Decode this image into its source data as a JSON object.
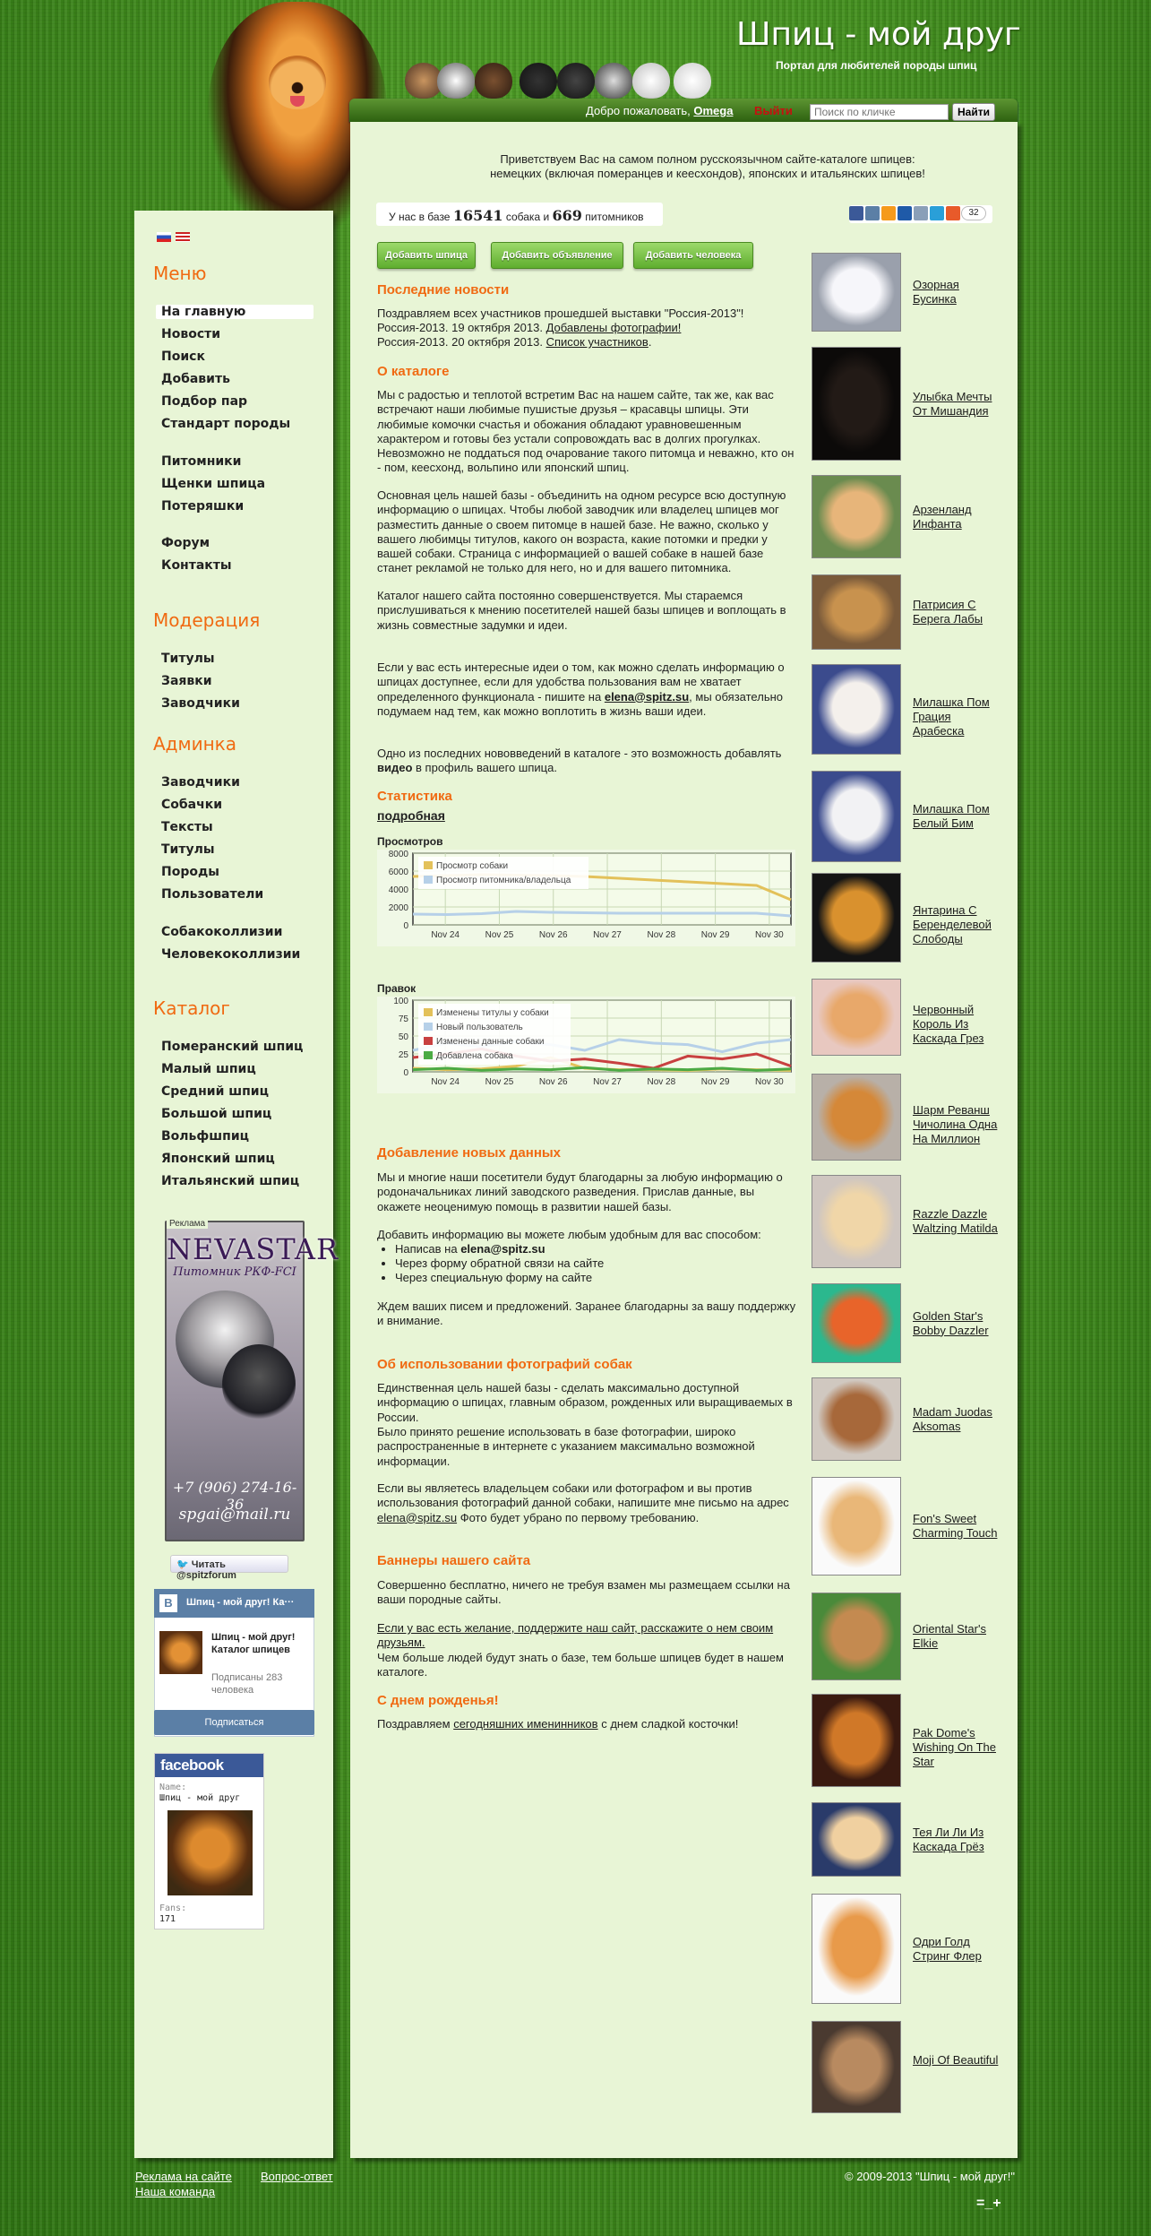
{
  "header": {
    "title": "Шпиц - мой друг",
    "subtitle": "Портал для любителей породы шпиц"
  },
  "topbar": {
    "welcome": "Добро пожаловать,",
    "user": "Omega",
    "logout": "Выйти",
    "search_placeholder": "Поиск по кличке",
    "search_button": "Найти"
  },
  "sidebar": {
    "menu_title": "Меню",
    "menu": [
      "На главную",
      "Новости",
      "Поиск",
      "Добавить",
      "Подбор пар",
      "Стандарт породы"
    ],
    "menu2": [
      "Питомники",
      "Щенки шпица",
      "Потеряшки"
    ],
    "menu3": [
      "Форум",
      "Контакты"
    ],
    "moderation_title": "Модерация",
    "moderation": [
      "Титулы",
      "Заявки",
      "Заводчики"
    ],
    "admin_title": "Админка",
    "admin": [
      "Заводчики",
      "Собачки",
      "Тексты",
      "Титулы",
      "Породы",
      "Пользователи"
    ],
    "admin2": [
      "Собакоколлизии",
      "Человекоколлизии"
    ],
    "catalog_title": "Каталог",
    "catalog": [
      "Померанский шпиц",
      "Малый шпиц",
      "Средний шпиц",
      "Большой шпиц",
      "Вольфшпиц",
      "Японский шпиц",
      "Итальянский шпиц"
    ],
    "ad_label": "Реклама",
    "ad_title": "NEVASTAR",
    "ad_sub": "Питомник РКФ-FCI",
    "ad_phone": "+7 (906) 274-16-36",
    "ad_email": "spgai@mail.ru",
    "twitter": "Читать @spitzforum",
    "vk": {
      "header": "Шпиц - мой друг! Ка···",
      "logo": "В",
      "name": "Шпиц - мой друг! Каталог шпицев",
      "subs": "Подписаны 283 человека",
      "button": "Подписаться"
    },
    "fb": {
      "header": "facebook",
      "name_label": "Name:",
      "name": "Шпиц - мой друг",
      "fans_label": "Fans:",
      "fans": "171"
    }
  },
  "main": {
    "greeting": "Приветствуем Вас на самом полном русскоязычном сайте-каталоге шпицев: немецких (включая померанцев и кеесхондов), японских и итальянских шпицев!",
    "count_pre": "У нас в базе",
    "dogs": "16541",
    "count_mid": "собака и",
    "kennels": "669",
    "count_post": "питомников",
    "share_count": "32",
    "buttons": [
      "Добавить шпица",
      "Добавить объявление",
      "Добавить человека"
    ],
    "news_title": "Последние новости",
    "news_1": "Поздравляем всех участников прошедшей выставки \"Россия-2013\"!",
    "news_2_pre": "Россия-2013. 19 октября 2013.",
    "news_2_link": "Добавлены фотографии!",
    "news_3_pre": "Россия-2013. 20 октября 2013.",
    "news_3_link": "Список участников",
    "about_title": "О каталоге",
    "about_1": "Мы с радостью и теплотой встретим Вас на нашем сайте, так же, как вас встречают наши любимые пушистые друзья – красавцы шпицы. Эти любимые комочки счастья и обожания обладают уравновешенным характером и готовы без устали сопровождать вас в долгих прогулках. Невозможно не поддаться под очарование такого питомца и неважно, кто он - пом, кеесхонд, вольпино или японский шпиц.",
    "about_2": "Основная цель нашей базы - объединить на одном ресурсе всю доступную информацию о шпицах. Чтобы любой заводчик или владелец шпицев мог разместить данные о своем питомце в нашей базе. Не важно, сколько у вашего любимцы титулов, какого он возраста, какие потомки и предки у вашей собаки. Страница с информацией о вашей собаке в нашей базе станет рекламой не только для него, но и для вашего питомника.",
    "about_3": "Каталог нашего сайта постоянно совершенствуется. Мы стараемся прислушиваться к мнению посетителей нашей базы шпицев и воплощать в жизнь совместные задумки и идеи.",
    "about_4_pre": "Если у вас есть интересные идеи о том, как можно сделать информацию о шпицах доступнее, если для удобства пользования вам не хватает определенного функционала - пишите на",
    "about_4_link": "elena@spitz.su",
    "about_4_post": ", мы обязательно подумаем над тем, как можно воплотить в жизнь ваши идеи.",
    "about_5_pre": "Одно из последних нововведений в каталоге - это возможность добавлять",
    "about_5_bold": "видео",
    "about_5_post": "в профиль вашего шпица.",
    "stats_title": "Статистика",
    "stats_link": "подробная",
    "views_label": "Просмотров",
    "edits_label": "Правок",
    "add_title": "Добавление новых данных",
    "add_1": "Мы и многие наши посетители будут благодарны за любую информацию о родоначальниках линий заводского разведения. Прислав данные, вы окажете неоценимую помощь в развитии нашей базы.",
    "add_2": "Добавить информацию вы можете любым удобным для вас способом:",
    "add_li1_pre": "Написав на",
    "add_li1_link": "elena@spitz.su",
    "add_li2": "Через форму обратной связи на сайте",
    "add_li3": "Через специальную форму на сайте",
    "add_3": "Ждем ваших писем и предложений. Заранее благодарны за вашу поддержку и внимание.",
    "photo_title": "Об использовании фотографий собак",
    "photo_1": "Единственная цель нашей базы - сделать максимально доступной информацию о шпицах, главным образом, рожденных или выращиваемых в России.",
    "photo_2": "Было принято решение использовать в базе фотографии, широко распространенные в интернете с указанием максимально возможной информации.",
    "photo_3": "Если вы являетесь владельцем собаки или фотографом и вы против использования фотографий данной собаки, напишите мне письмо на адрес",
    "photo_3_link": "elena@spitz.su",
    "photo_3_post": "Фото будет убрано по первому требованию.",
    "banner_title": "Баннеры нашего сайта",
    "banner_1": "Совершенно бесплатно, ничего не требуя взамен мы размещаем ссылки на ваши породные сайты.",
    "banner_2_link": "Если у вас есть желание, поддержите наш сайт, расскажите о нем своим друзьям.",
    "banner_2_post": "Чем больше людей будут знать о базе, тем больше шпицев будет в нашем каталоге.",
    "bday_title": "С днем рожденья!",
    "bday_pre": "Поздравляем",
    "bday_link": "сегодняшних именинников",
    "bday_post": "с днем сладкой косточки!"
  },
  "chart_data": [
    {
      "type": "line",
      "categories": [
        "Nov 24",
        "Nov 25",
        "Nov 26",
        "Nov 27",
        "Nov 28",
        "Nov 29",
        "Nov 30"
      ],
      "ylim": [
        0,
        8000
      ],
      "yticks": [
        0,
        2000,
        4000,
        6000,
        8000
      ],
      "series": [
        {
          "name": "Просмотр собаки",
          "color": "#e3c15a",
          "values": [
            5400,
            5500,
            5600,
            5550,
            5500,
            5400,
            5200,
            5000,
            4800,
            4600,
            4400,
            2800
          ]
        },
        {
          "name": "Просмотр питомника/владельца",
          "color": "#b6d0e8",
          "values": [
            1200,
            1150,
            1250,
            1500,
            1400,
            1350,
            1300,
            1300,
            1300,
            1300,
            1300,
            1000
          ]
        }
      ]
    },
    {
      "type": "line",
      "categories": [
        "Nov 24",
        "Nov 25",
        "Nov 26",
        "Nov 27",
        "Nov 28",
        "Nov 29",
        "Nov 30"
      ],
      "ylim": [
        0,
        100
      ],
      "yticks": [
        0,
        25,
        50,
        75,
        100
      ],
      "series": [
        {
          "name": "Изменены титулы у собаки",
          "color": "#e3c15a",
          "values": [
            5,
            3,
            4,
            8,
            20,
            5,
            3,
            3,
            2,
            4,
            3,
            2
          ]
        },
        {
          "name": "Новый пользователь",
          "color": "#b6d0e8",
          "values": [
            30,
            40,
            35,
            42,
            38,
            30,
            45,
            40,
            38,
            28,
            40,
            45
          ]
        },
        {
          "name": "Изменены данные собаки",
          "color": "#c84040",
          "values": [
            20,
            25,
            32,
            22,
            15,
            18,
            12,
            5,
            22,
            18,
            25,
            8
          ]
        },
        {
          "name": "Добавлена собака",
          "color": "#4caa44",
          "values": [
            3,
            5,
            2,
            4,
            3,
            6,
            2,
            4,
            3,
            5,
            2,
            4
          ]
        }
      ]
    }
  ],
  "dogs": [
    {
      "name": "Озорная Бусинка",
      "c1": "#f6f6fa",
      "c2": "#9aa0ac"
    },
    {
      "name": "Улыбка Мечты От Мишандия",
      "c1": "#221a16",
      "c2": "#0c0a09"
    },
    {
      "name": "Арзенланд Инфанта",
      "c1": "#e7b57a",
      "c2": "#6a8b4f"
    },
    {
      "name": "Патрисия С Берега Лабы",
      "c1": "#c8924e",
      "c2": "#7a5a3a"
    },
    {
      "name": "Милашка Пом Грация Арабеска",
      "c1": "#f4f0ec",
      "c2": "#3b4b8d"
    },
    {
      "name": "Милашка Пом Белый Бим",
      "c1": "#f2f2f4",
      "c2": "#3b4b8d"
    },
    {
      "name": "Янтарина С Беренделевой Слободы",
      "c1": "#d9912e",
      "c2": "#141414"
    },
    {
      "name": "Червонный Король Из Каскада Грез",
      "c1": "#e8a86a",
      "c2": "#e8c8c0"
    },
    {
      "name": "Шарм Реванш Чичолина Одна На Миллион",
      "c1": "#d58838",
      "c2": "#b8b0a8"
    },
    {
      "name": "Razzle Dazzle Waltzing Matilda",
      "c1": "#f0d6a8",
      "c2": "#cfc6c0"
    },
    {
      "name": "Golden Star's Bobby Dazzler",
      "c1": "#e8642a",
      "c2": "#2bb88e"
    },
    {
      "name": "Madam Juodas Aksomas",
      "c1": "#a7683a",
      "c2": "#d0c8c0"
    },
    {
      "name": "Fon's Sweet Charming Touch",
      "c1": "#e9b778",
      "c2": "#fafafa"
    },
    {
      "name": "Oriental Star's Elkie",
      "c1": "#c48a50",
      "c2": "#4a8a3a"
    },
    {
      "name": "Pak Dome's Wishing On The Star",
      "c1": "#d07828",
      "c2": "#3a1a10"
    },
    {
      "name": "Тея Ли Ли Из Каскада Грёз",
      "c1": "#f0d0a0",
      "c2": "#2a3b6a"
    },
    {
      "name": "Одри Голд Стринг Флер",
      "c1": "#e89a4a",
      "c2": "#fafafa"
    },
    {
      "name": "Moji Of Beautiful",
      "c1": "#b88a60",
      "c2": "#4a3a30"
    }
  ],
  "footer": {
    "ads": "Реклама на сайте",
    "faq": "Вопрос-ответ",
    "team": "Наша команда",
    "copyright": "© 2009-2013 \"Шпиц - мой друг!\"",
    "zoom": "=_+"
  }
}
